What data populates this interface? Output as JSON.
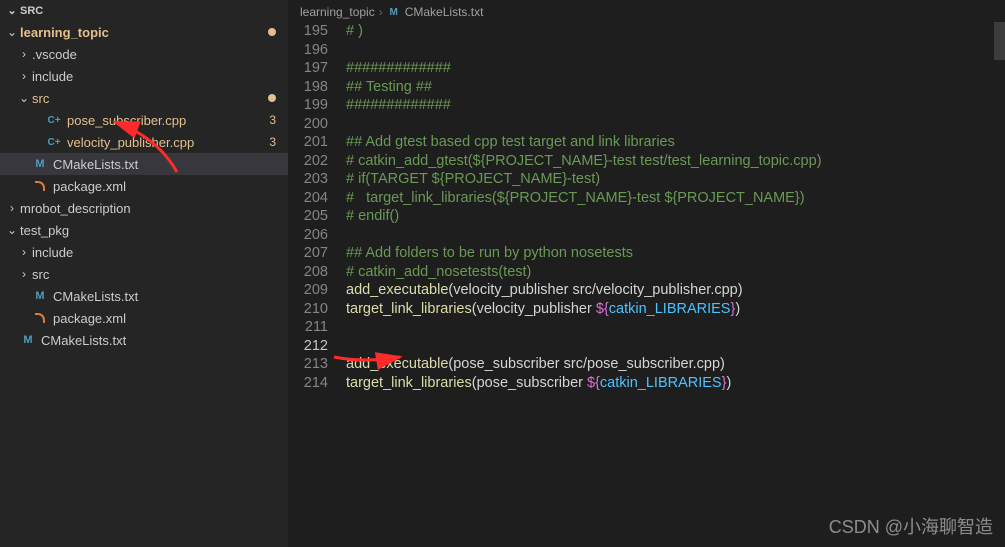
{
  "sidebar": {
    "headerLabel": "SRC",
    "tree": [
      {
        "type": "folder",
        "label": "learning_topic",
        "indent": 0,
        "expanded": true,
        "root": true,
        "gitMod": true,
        "dot": true
      },
      {
        "type": "folder",
        "label": ".vscode",
        "indent": 1,
        "expanded": false
      },
      {
        "type": "folder",
        "label": "include",
        "indent": 1,
        "expanded": false
      },
      {
        "type": "folder",
        "label": "src",
        "indent": 1,
        "expanded": true,
        "gitMod": true,
        "dot": true
      },
      {
        "type": "file",
        "label": "pose_subscriber.cpp",
        "indent": 2,
        "icon": "cpp",
        "gitMod": true,
        "gitBadge": "3"
      },
      {
        "type": "file",
        "label": "velocity_publisher.cpp",
        "indent": 2,
        "icon": "cpp",
        "gitMod": true,
        "gitBadge": "3"
      },
      {
        "type": "file",
        "label": "CMakeLists.txt",
        "indent": 1,
        "icon": "cmake",
        "selected": true
      },
      {
        "type": "file",
        "label": "package.xml",
        "indent": 1,
        "icon": "rss"
      },
      {
        "type": "folder",
        "label": "mrobot_description",
        "indent": 0,
        "expanded": false
      },
      {
        "type": "folder",
        "label": "test_pkg",
        "indent": 0,
        "expanded": true
      },
      {
        "type": "folder",
        "label": "include",
        "indent": 1,
        "expanded": false
      },
      {
        "type": "folder",
        "label": "src",
        "indent": 1,
        "expanded": false
      },
      {
        "type": "file",
        "label": "CMakeLists.txt",
        "indent": 1,
        "icon": "cmake"
      },
      {
        "type": "file",
        "label": "package.xml",
        "indent": 1,
        "icon": "rss"
      },
      {
        "type": "file",
        "label": "CMakeLists.txt",
        "indent": 0,
        "icon": "cmake"
      }
    ]
  },
  "breadcrumb": {
    "folder": "learning_topic",
    "fileIcon": "M",
    "file": "CMakeLists.txt"
  },
  "code": {
    "startLine": 194,
    "cursorLine": 212,
    "lines": [
      [
        {
          "c": "cmt",
          "t": "# )"
        }
      ],
      [
        {
          "c": "cmt",
          "t": "# )"
        }
      ],
      [],
      [
        {
          "c": "cmt",
          "t": "#############"
        }
      ],
      [
        {
          "c": "cmt",
          "t": "## Testing ##"
        }
      ],
      [
        {
          "c": "cmt",
          "t": "#############"
        }
      ],
      [],
      [
        {
          "c": "cmt",
          "t": "## Add gtest based cpp test target and link libraries"
        }
      ],
      [
        {
          "c": "cmt",
          "t": "# catkin_add_gtest(${PROJECT_NAME}-test test/test_learning_topic.cpp)"
        }
      ],
      [
        {
          "c": "cmt",
          "t": "# if(TARGET ${PROJECT_NAME}-test)"
        }
      ],
      [
        {
          "c": "cmt",
          "t": "#   target_link_libraries(${PROJECT_NAME}-test ${PROJECT_NAME})"
        }
      ],
      [
        {
          "c": "cmt",
          "t": "# endif()"
        }
      ],
      [],
      [
        {
          "c": "cmt",
          "t": "## Add folders to be run by python nosetests"
        }
      ],
      [
        {
          "c": "cmt",
          "t": "# catkin_add_nosetests(test)"
        }
      ],
      [
        {
          "c": "fn",
          "t": "add_executable"
        },
        {
          "c": "pl",
          "t": "(velocity_publisher src/velocity_publisher.cpp)"
        }
      ],
      [
        {
          "c": "fn",
          "t": "target_link_libraries"
        },
        {
          "c": "pl",
          "t": "(velocity_publisher "
        },
        {
          "c": "brc",
          "t": "${"
        },
        {
          "c": "var",
          "t": "catkin_LIBRARIES"
        },
        {
          "c": "brc",
          "t": "}"
        },
        {
          "c": "pl",
          "t": ")"
        }
      ],
      [],
      [],
      [
        {
          "c": "fn",
          "t": "add_executable"
        },
        {
          "c": "pl",
          "t": "(pose_subscriber src/pose_subscriber.cpp)"
        }
      ],
      [
        {
          "c": "fn",
          "t": "target_link_libraries"
        },
        {
          "c": "pl",
          "t": "(pose_subscriber "
        },
        {
          "c": "brc",
          "t": "${"
        },
        {
          "c": "var",
          "t": "catkin_LIBRARIES"
        },
        {
          "c": "brc",
          "t": "}"
        },
        {
          "c": "pl",
          "t": ")"
        }
      ]
    ]
  },
  "watermark": "CSDN @小海聊智造"
}
